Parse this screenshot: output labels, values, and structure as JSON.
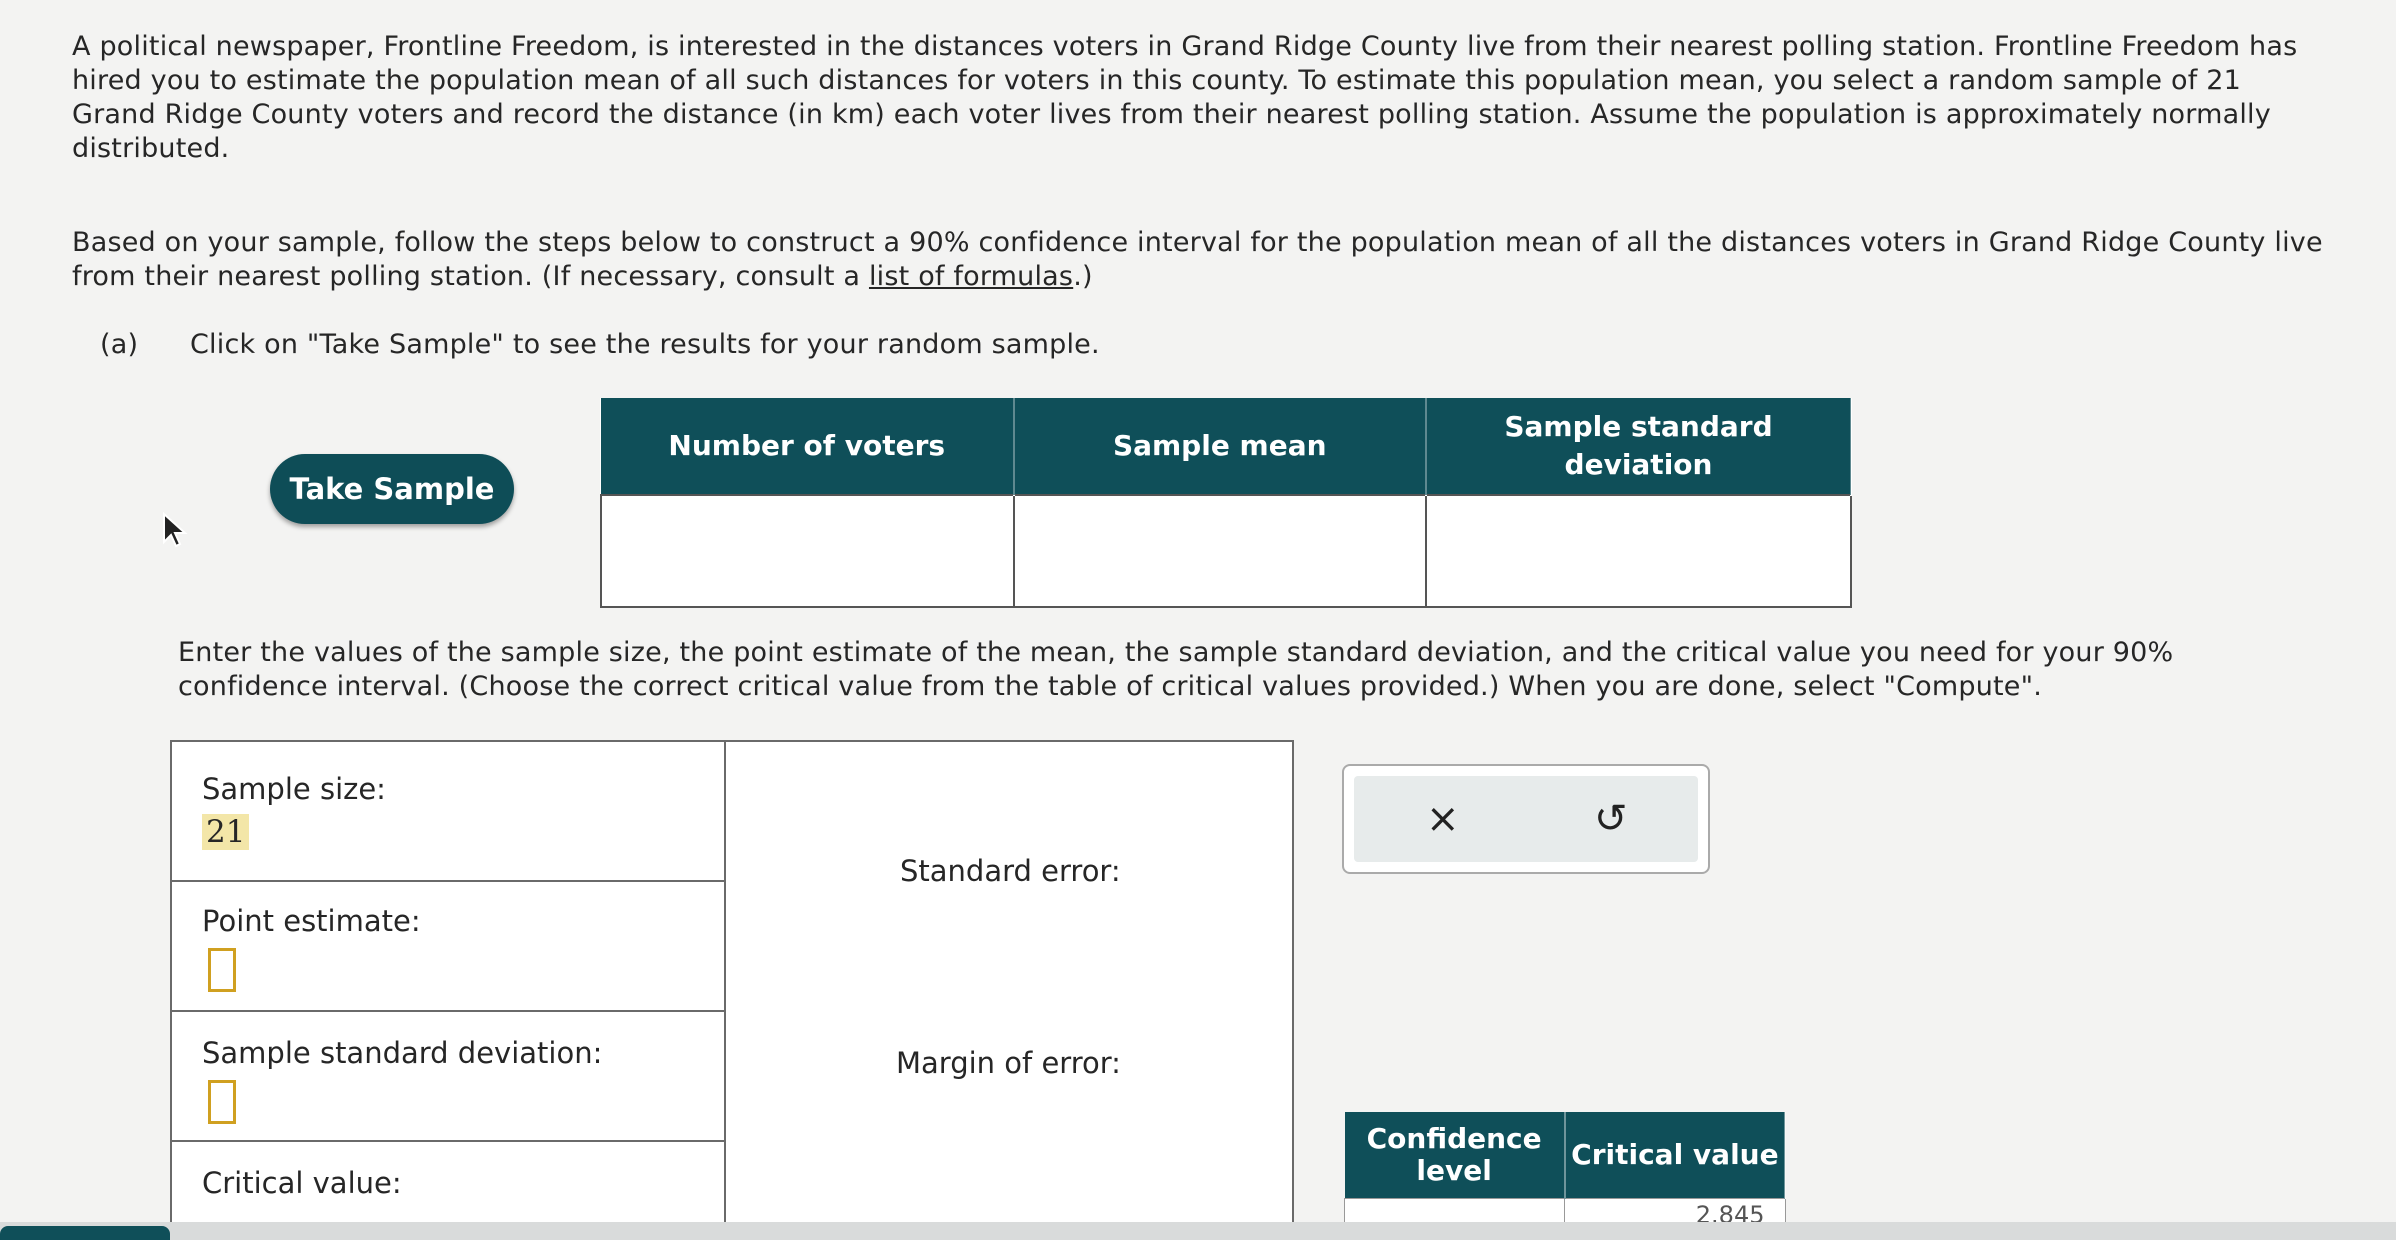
{
  "question": {
    "intro": "A political newspaper, Frontline Freedom, is interested in the distances voters in Grand Ridge County live from their nearest polling station. Frontline Freedom has hired you to estimate the population mean of all such distances for voters in this county. To estimate this population mean, you select a random sample of 21 Grand Ridge County voters and record the distance (in km) each voter lives from their nearest polling station. Assume the population is approximately normally distributed.",
    "instructions_before_link": "Based on your sample, follow the steps below to construct a 90% confidence interval for the population mean of all the distances voters in Grand Ridge County live from their nearest polling station. (If necessary, consult a ",
    "link_text": "list of formulas",
    "instructions_after_link": ".)",
    "part_a_tag": "(a)",
    "part_a_text": "Click on \"Take Sample\" to see the results for your random sample."
  },
  "take_sample_label": "Take Sample",
  "results_table": {
    "headers": [
      "Number of voters",
      "Sample mean",
      "Sample standard deviation"
    ],
    "row": [
      "",
      "",
      ""
    ]
  },
  "enter_text": "Enter the values of the sample size, the point estimate of the mean, the sample standard deviation, and the critical value you need for your 90% confidence interval. (Choose the correct critical value from the table of critical values provided.) When you are done, select \"Compute\".",
  "form": {
    "sample_size_label": "Sample size:",
    "sample_size_value": "21",
    "point_estimate_label": "Point estimate:",
    "sample_sd_label": "Sample standard deviation:",
    "critical_value_label": "Critical value:",
    "standard_error_label": "Standard error:",
    "margin_of_error_label": "Margin of error:"
  },
  "tools": {
    "clear_icon": "×",
    "undo_icon": "↺"
  },
  "critical_table": {
    "headers": [
      "Confidence level",
      "Critical value"
    ],
    "first_row": [
      "",
      "2.845"
    ]
  }
}
